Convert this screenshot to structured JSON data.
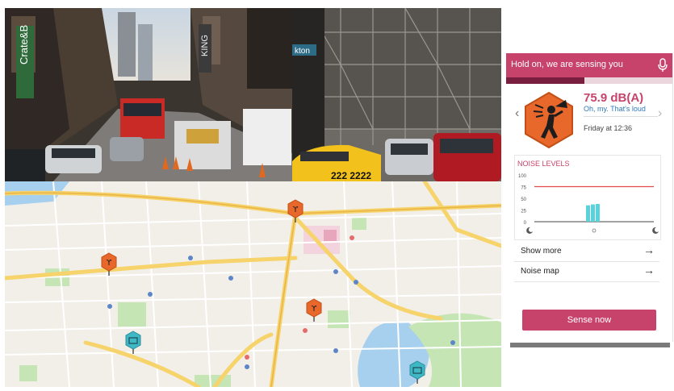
{
  "app": {
    "header_title": "Hold on, we are sensing you",
    "sensing_progress": 0.47,
    "decibel_value": "75.9 dB(A)",
    "comment": "Oh, my. That's loud",
    "timestamp": "Friday at 12:36",
    "noise_chart": {
      "title": "NOISE LEVELS",
      "y_ticks": [
        "100",
        "75",
        "50",
        "25",
        "0"
      ],
      "threshold_value": 75,
      "bars": [
        35,
        37,
        38
      ],
      "x_icons": [
        "moon-icon",
        "sun-icon",
        "moon-icon"
      ]
    },
    "menu": [
      {
        "label": "Show more",
        "arrow": "→"
      },
      {
        "label": "Noise map",
        "arrow": "→"
      }
    ],
    "sense_button": "Sense now"
  },
  "photo_left": {
    "signs": [
      "Crate&B",
      "KING"
    ]
  },
  "photo_right": {
    "signs": [
      "kton"
    ],
    "taxi_number": "222 2222"
  },
  "colors": {
    "accent": "#c8436b",
    "noise_marker": "#e8672a",
    "quiet_marker": "#3fb7c4",
    "bar": "#5ad2dc"
  }
}
